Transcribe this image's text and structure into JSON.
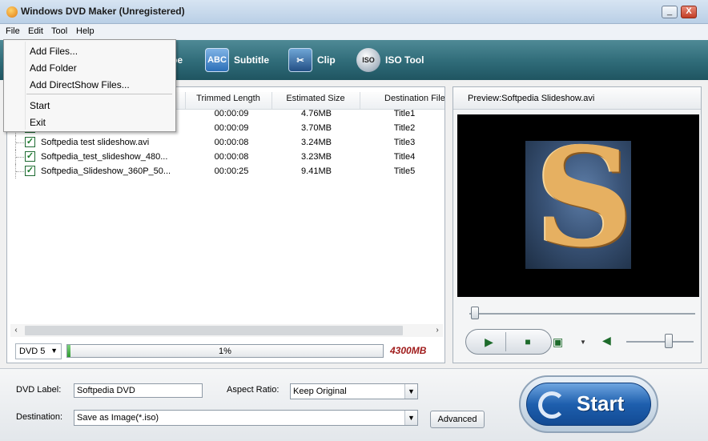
{
  "window": {
    "title": "Windows DVD Maker (Unregistered)",
    "minimize_label": "_",
    "close_label": "X"
  },
  "menu": {
    "file": "File",
    "edit": "Edit",
    "tool": "Tool",
    "help": "Help"
  },
  "file_menu": {
    "items": [
      "Add Files...",
      "Add Folder",
      "Add DirectShow Files...",
      "Start",
      "Exit"
    ]
  },
  "toolbar": {
    "partial_label": "be",
    "subtitle": "Subtitle",
    "subtitle_icon_text": "ABC",
    "clip": "Clip",
    "iso_tool": "ISO Tool",
    "iso_icon_text": "ISO"
  },
  "file_list": {
    "columns": [
      "Trimmed Length",
      "Estimated Size",
      "Destination File"
    ],
    "rows": [
      {
        "name": "",
        "length": "00:00:09",
        "size": "4.76MB",
        "dest": "Title1",
        "checked": true
      },
      {
        "name": "",
        "length": "00:00:09",
        "size": "3.70MB",
        "dest": "Title2",
        "checked": true
      },
      {
        "name": "Softpedia test slideshow.avi",
        "length": "00:00:08",
        "size": "3.24MB",
        "dest": "Title3",
        "checked": true
      },
      {
        "name": "Softpedia_test_slideshow_480...",
        "length": "00:00:08",
        "size": "3.23MB",
        "dest": "Title4",
        "checked": true
      },
      {
        "name": "Softpedia_Slideshow_360P_50...",
        "length": "00:00:25",
        "size": "9.41MB",
        "dest": "Title5",
        "checked": true
      }
    ]
  },
  "disc": {
    "type": "DVD 5",
    "progress_fraction": 0.01,
    "progress_label": "1%",
    "capacity": "4300MB"
  },
  "preview": {
    "header": "Preview:Softpedia Slideshow.avi",
    "seek_fraction": 0.0,
    "volume_fraction": 0.6
  },
  "settings": {
    "dvd_label_caption": "DVD Label:",
    "dvd_label_value": "Softpedia DVD",
    "aspect_caption": "Aspect Ratio:",
    "aspect_value": "Keep Original",
    "destination_caption": "Destination:",
    "destination_value": "Save as Image(*.iso)",
    "advanced": "Advanced",
    "start": "Start"
  },
  "colors": {
    "toolbar": "#2f6b78",
    "capacity_text": "#a01c1c",
    "start_button": "#1e5fae",
    "progress_fill": "#2f9a2f"
  }
}
